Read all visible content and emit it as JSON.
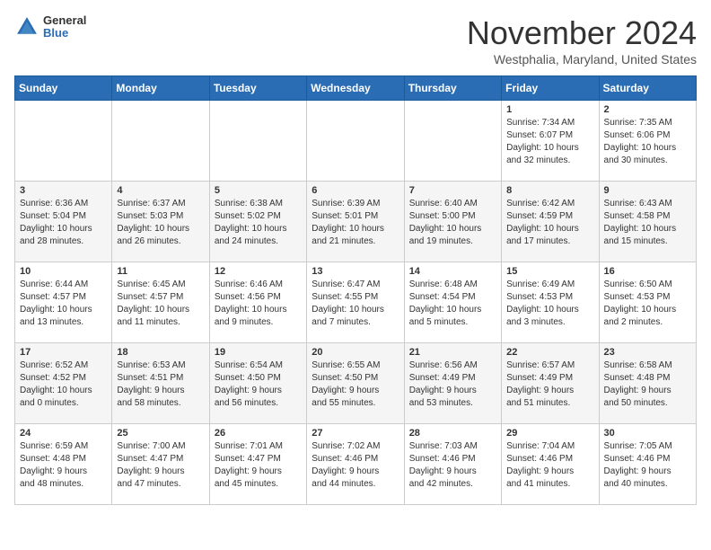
{
  "header": {
    "logo": {
      "general": "General",
      "blue": "Blue"
    },
    "title": "November 2024",
    "location": "Westphalia, Maryland, United States"
  },
  "calendar": {
    "days_of_week": [
      "Sunday",
      "Monday",
      "Tuesday",
      "Wednesday",
      "Thursday",
      "Friday",
      "Saturday"
    ],
    "weeks": [
      [
        {
          "day": "",
          "info": ""
        },
        {
          "day": "",
          "info": ""
        },
        {
          "day": "",
          "info": ""
        },
        {
          "day": "",
          "info": ""
        },
        {
          "day": "",
          "info": ""
        },
        {
          "day": "1",
          "info": "Sunrise: 7:34 AM\nSunset: 6:07 PM\nDaylight: 10 hours\nand 32 minutes."
        },
        {
          "day": "2",
          "info": "Sunrise: 7:35 AM\nSunset: 6:06 PM\nDaylight: 10 hours\nand 30 minutes."
        }
      ],
      [
        {
          "day": "3",
          "info": "Sunrise: 6:36 AM\nSunset: 5:04 PM\nDaylight: 10 hours\nand 28 minutes."
        },
        {
          "day": "4",
          "info": "Sunrise: 6:37 AM\nSunset: 5:03 PM\nDaylight: 10 hours\nand 26 minutes."
        },
        {
          "day": "5",
          "info": "Sunrise: 6:38 AM\nSunset: 5:02 PM\nDaylight: 10 hours\nand 24 minutes."
        },
        {
          "day": "6",
          "info": "Sunrise: 6:39 AM\nSunset: 5:01 PM\nDaylight: 10 hours\nand 21 minutes."
        },
        {
          "day": "7",
          "info": "Sunrise: 6:40 AM\nSunset: 5:00 PM\nDaylight: 10 hours\nand 19 minutes."
        },
        {
          "day": "8",
          "info": "Sunrise: 6:42 AM\nSunset: 4:59 PM\nDaylight: 10 hours\nand 17 minutes."
        },
        {
          "day": "9",
          "info": "Sunrise: 6:43 AM\nSunset: 4:58 PM\nDaylight: 10 hours\nand 15 minutes."
        }
      ],
      [
        {
          "day": "10",
          "info": "Sunrise: 6:44 AM\nSunset: 4:57 PM\nDaylight: 10 hours\nand 13 minutes."
        },
        {
          "day": "11",
          "info": "Sunrise: 6:45 AM\nSunset: 4:57 PM\nDaylight: 10 hours\nand 11 minutes."
        },
        {
          "day": "12",
          "info": "Sunrise: 6:46 AM\nSunset: 4:56 PM\nDaylight: 10 hours\nand 9 minutes."
        },
        {
          "day": "13",
          "info": "Sunrise: 6:47 AM\nSunset: 4:55 PM\nDaylight: 10 hours\nand 7 minutes."
        },
        {
          "day": "14",
          "info": "Sunrise: 6:48 AM\nSunset: 4:54 PM\nDaylight: 10 hours\nand 5 minutes."
        },
        {
          "day": "15",
          "info": "Sunrise: 6:49 AM\nSunset: 4:53 PM\nDaylight: 10 hours\nand 3 minutes."
        },
        {
          "day": "16",
          "info": "Sunrise: 6:50 AM\nSunset: 4:53 PM\nDaylight: 10 hours\nand 2 minutes."
        }
      ],
      [
        {
          "day": "17",
          "info": "Sunrise: 6:52 AM\nSunset: 4:52 PM\nDaylight: 10 hours\nand 0 minutes."
        },
        {
          "day": "18",
          "info": "Sunrise: 6:53 AM\nSunset: 4:51 PM\nDaylight: 9 hours\nand 58 minutes."
        },
        {
          "day": "19",
          "info": "Sunrise: 6:54 AM\nSunset: 4:50 PM\nDaylight: 9 hours\nand 56 minutes."
        },
        {
          "day": "20",
          "info": "Sunrise: 6:55 AM\nSunset: 4:50 PM\nDaylight: 9 hours\nand 55 minutes."
        },
        {
          "day": "21",
          "info": "Sunrise: 6:56 AM\nSunset: 4:49 PM\nDaylight: 9 hours\nand 53 minutes."
        },
        {
          "day": "22",
          "info": "Sunrise: 6:57 AM\nSunset: 4:49 PM\nDaylight: 9 hours\nand 51 minutes."
        },
        {
          "day": "23",
          "info": "Sunrise: 6:58 AM\nSunset: 4:48 PM\nDaylight: 9 hours\nand 50 minutes."
        }
      ],
      [
        {
          "day": "24",
          "info": "Sunrise: 6:59 AM\nSunset: 4:48 PM\nDaylight: 9 hours\nand 48 minutes."
        },
        {
          "day": "25",
          "info": "Sunrise: 7:00 AM\nSunset: 4:47 PM\nDaylight: 9 hours\nand 47 minutes."
        },
        {
          "day": "26",
          "info": "Sunrise: 7:01 AM\nSunset: 4:47 PM\nDaylight: 9 hours\nand 45 minutes."
        },
        {
          "day": "27",
          "info": "Sunrise: 7:02 AM\nSunset: 4:46 PM\nDaylight: 9 hours\nand 44 minutes."
        },
        {
          "day": "28",
          "info": "Sunrise: 7:03 AM\nSunset: 4:46 PM\nDaylight: 9 hours\nand 42 minutes."
        },
        {
          "day": "29",
          "info": "Sunrise: 7:04 AM\nSunset: 4:46 PM\nDaylight: 9 hours\nand 41 minutes."
        },
        {
          "day": "30",
          "info": "Sunrise: 7:05 AM\nSunset: 4:46 PM\nDaylight: 9 hours\nand 40 minutes."
        }
      ]
    ]
  }
}
